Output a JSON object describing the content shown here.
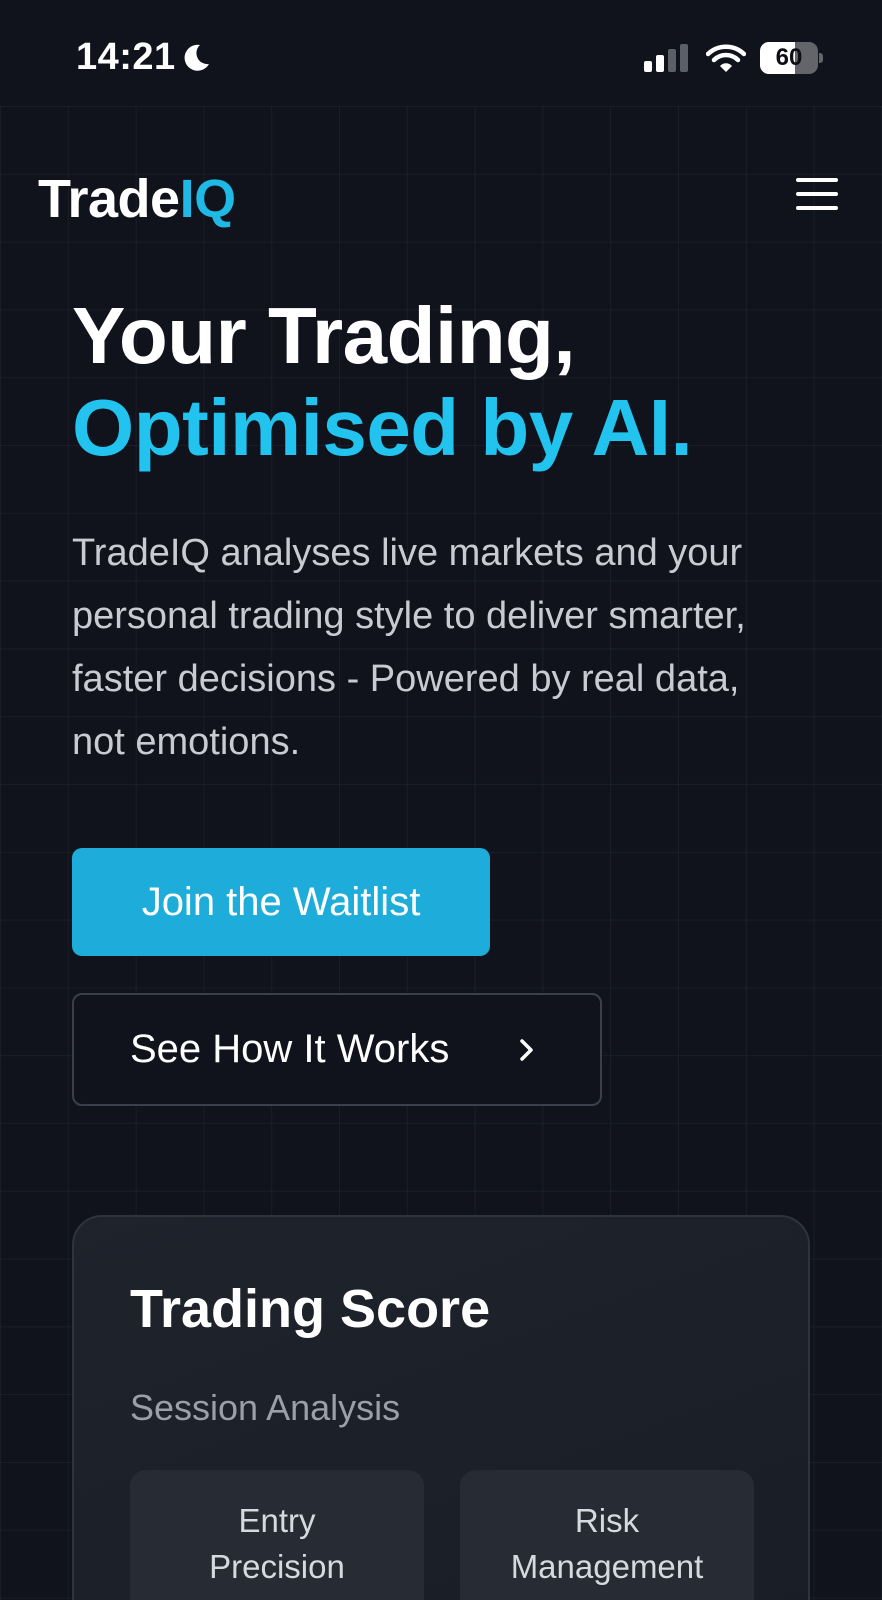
{
  "status_bar": {
    "time": "14:21",
    "battery": "60",
    "battery_level": 0.6
  },
  "nav": {
    "logo_part1": "Trade",
    "logo_part2": "IQ",
    "menu_icon": "hamburger-menu-icon"
  },
  "hero": {
    "headline_line1": "Your Trading,",
    "headline_line2": "Optimised by AI.",
    "description": "TradeIQ analyses live markets and your personal trading style to deliver smarter, faster decisions - Powered by real data, not emotions.",
    "primary_button": "Join the Waitlist",
    "secondary_button": "See How It Works"
  },
  "score_card": {
    "title": "Trading Score",
    "subtitle": "Session Analysis",
    "metrics": [
      {
        "label_line1": "Entry",
        "label_line2": "Precision"
      },
      {
        "label_line1": "Risk",
        "label_line2": "Management"
      }
    ]
  },
  "colors": {
    "background": "#10131c",
    "accent": "#22c4ef",
    "button": "#1eaddb"
  }
}
